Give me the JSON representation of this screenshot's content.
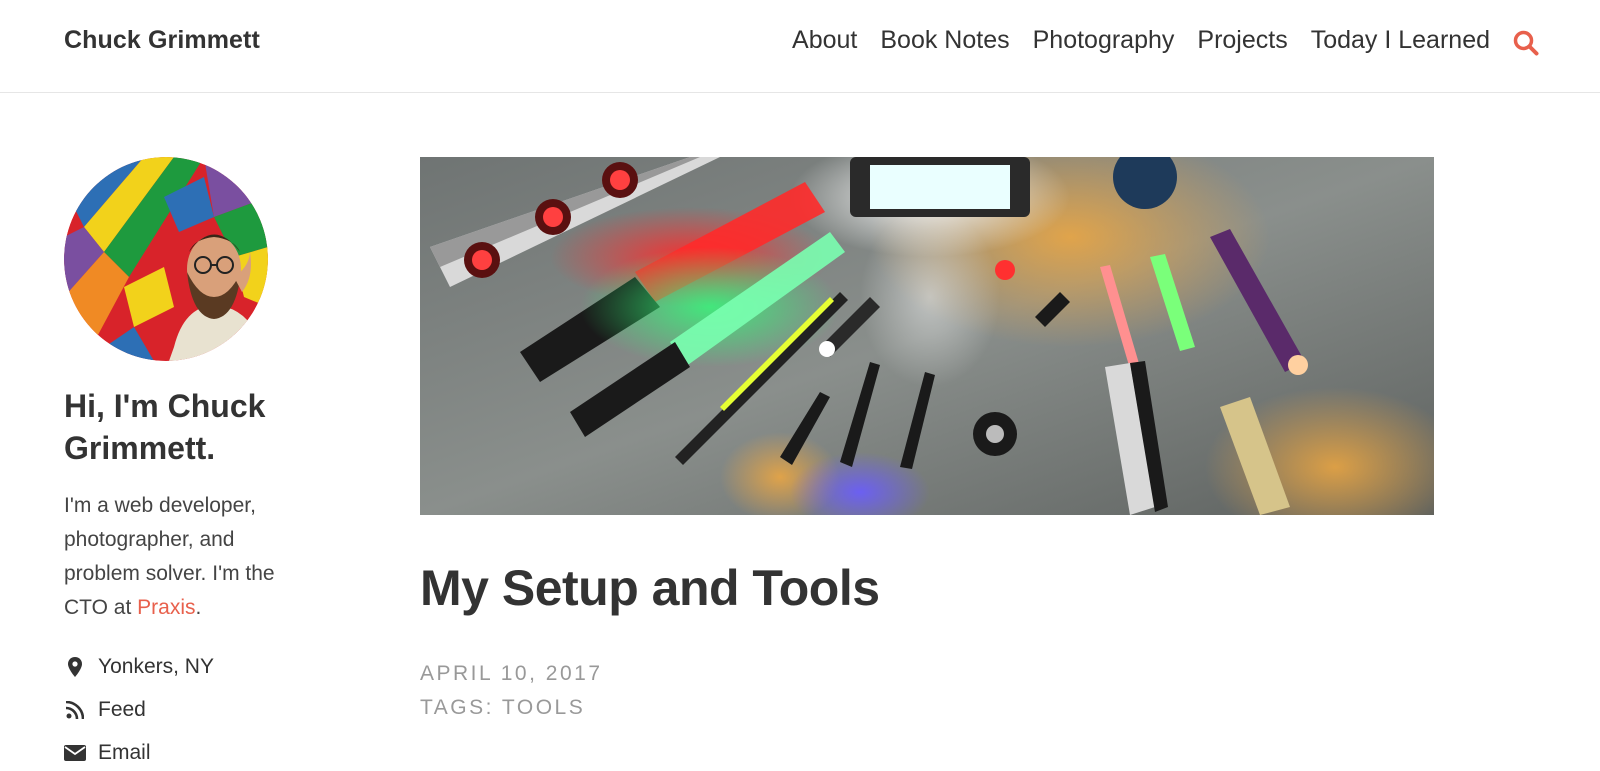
{
  "site": {
    "title": "Chuck Grimmett"
  },
  "nav": {
    "items": [
      {
        "label": "About"
      },
      {
        "label": "Book Notes"
      },
      {
        "label": "Photography"
      },
      {
        "label": "Projects"
      },
      {
        "label": "Today I Learned"
      }
    ],
    "search_icon": "search-icon"
  },
  "sidebar": {
    "name": "Hi, I'm Chuck Grimmett.",
    "bio_prefix": "I'm a web developer, photographer, and problem solver. I'm the CTO at ",
    "bio_link": "Praxis",
    "bio_suffix": ".",
    "links": [
      {
        "icon": "map-marker-icon",
        "label": "Yonkers, NY"
      },
      {
        "icon": "rss-icon",
        "label": "Feed"
      },
      {
        "icon": "envelope-icon",
        "label": "Email"
      }
    ]
  },
  "post": {
    "title": "My Setup and Tools",
    "date": "APRIL 10, 2017",
    "tags_label": "TAGS: ",
    "tag": "TOOLS"
  },
  "colors": {
    "accent": "#e8604c",
    "text": "#333333",
    "muted": "#999999",
    "rule": "#e6e6e6"
  }
}
